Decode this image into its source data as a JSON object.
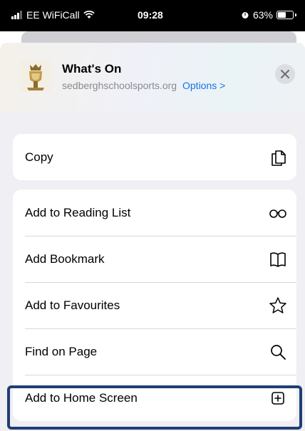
{
  "status": {
    "carrier": "EE WiFiCall",
    "time": "09:28",
    "battery_percent": "63%",
    "battery_level": 0.63
  },
  "share_sheet": {
    "title": "What's On",
    "domain": "sedberghschoolsports.org",
    "options_label": "Options >",
    "close_icon": "close-icon"
  },
  "actions": {
    "copy": {
      "label": "Copy",
      "icon": "copy-icon"
    },
    "items": [
      {
        "label": "Add to Reading List",
        "icon": "glasses-icon"
      },
      {
        "label": "Add Bookmark",
        "icon": "book-icon"
      },
      {
        "label": "Add to Favourites",
        "icon": "star-icon"
      },
      {
        "label": "Find on Page",
        "icon": "magnifier-icon"
      },
      {
        "label": "Add to Home Screen",
        "icon": "add-square-icon"
      }
    ]
  },
  "colors": {
    "accent": "#1573e8",
    "highlight_border": "#1f3f73"
  }
}
